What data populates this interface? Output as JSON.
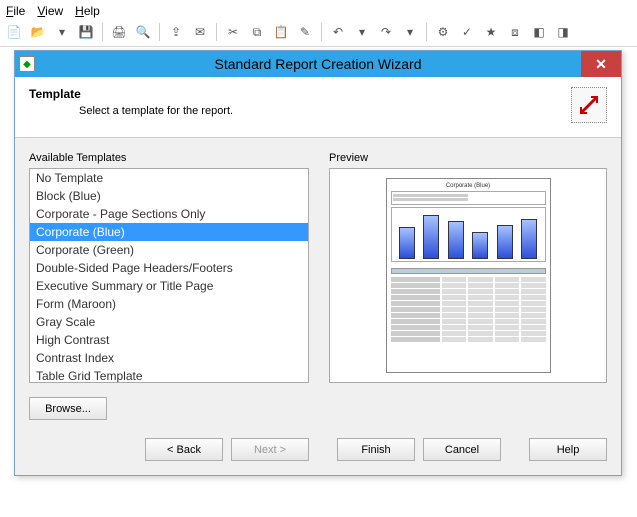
{
  "menu": {
    "file": "File",
    "view": "View",
    "help": "Help"
  },
  "dialog": {
    "title": "Standard Report Creation Wizard",
    "header_title": "Template",
    "header_desc": "Select a template for the report.",
    "available_label": "Available Templates",
    "preview_label": "Preview",
    "browse_label": "Browse...",
    "back_label": "< Back",
    "next_label": "Next >",
    "finish_label": "Finish",
    "cancel_label": "Cancel",
    "help_label": "Help"
  },
  "templates": [
    {
      "label": "No Template",
      "selected": false
    },
    {
      "label": "Block (Blue)",
      "selected": false
    },
    {
      "label": "Corporate - Page Sections Only",
      "selected": false
    },
    {
      "label": "Corporate (Blue)",
      "selected": true
    },
    {
      "label": "Corporate (Green)",
      "selected": false
    },
    {
      "label": "Double-Sided Page Headers/Footers",
      "selected": false
    },
    {
      "label": "Executive Summary or Title Page",
      "selected": false
    },
    {
      "label": "Form (Maroon)",
      "selected": false
    },
    {
      "label": "Gray Scale",
      "selected": false
    },
    {
      "label": "High Contrast",
      "selected": false
    },
    {
      "label": "Contrast Index",
      "selected": false
    },
    {
      "label": "Table Grid Template",
      "selected": false
    }
  ],
  "preview": {
    "title": "Corporate (Blue)"
  }
}
